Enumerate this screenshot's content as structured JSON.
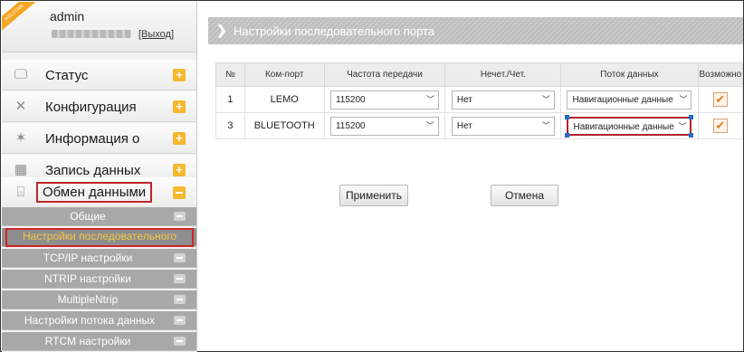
{
  "sidebar": {
    "ribbon_text": "WELCOME",
    "user": "admin",
    "logout_label": "[Выход]",
    "menu": [
      {
        "label": "Статус",
        "icon": "monitor-icon"
      },
      {
        "label": "Конфигурация",
        "icon": "tools-icon"
      },
      {
        "label": "Информация о",
        "icon": "satellite-icon"
      },
      {
        "label": "Запись данных",
        "icon": "calendar-icon"
      },
      {
        "label": "Обмен данными",
        "icon": "network-icon"
      }
    ],
    "submenu": [
      {
        "label": "Общие"
      },
      {
        "label": "Настройки последовательного"
      },
      {
        "label": "TCP/IP настройки"
      },
      {
        "label": "NTRIP настройки"
      },
      {
        "label": "MultipleNtrip"
      },
      {
        "label": "Настройки потока данных"
      },
      {
        "label": "RTCM настройки"
      }
    ]
  },
  "main": {
    "title": "Настройки последовательного порта",
    "table": {
      "headers": [
        "№",
        "Ком-порт",
        "Частота передачи",
        "Нечет./Чет.",
        "Поток данных",
        "Возможно"
      ],
      "rows": [
        {
          "num": "1",
          "port": "LEMO",
          "baud": "115200",
          "parity": "Нет",
          "stream": "Навигационные данные",
          "enabled": true
        },
        {
          "num": "3",
          "port": "BLUETOOTH",
          "baud": "115200",
          "parity": "Нет",
          "stream": "Навигационные данные",
          "enabled": true
        }
      ]
    },
    "apply_label": "Применить",
    "cancel_label": "Отмена"
  },
  "colors": {
    "accent": "#f5b82e",
    "highlight": "#c0242b",
    "selected_text": "#f5c542"
  }
}
